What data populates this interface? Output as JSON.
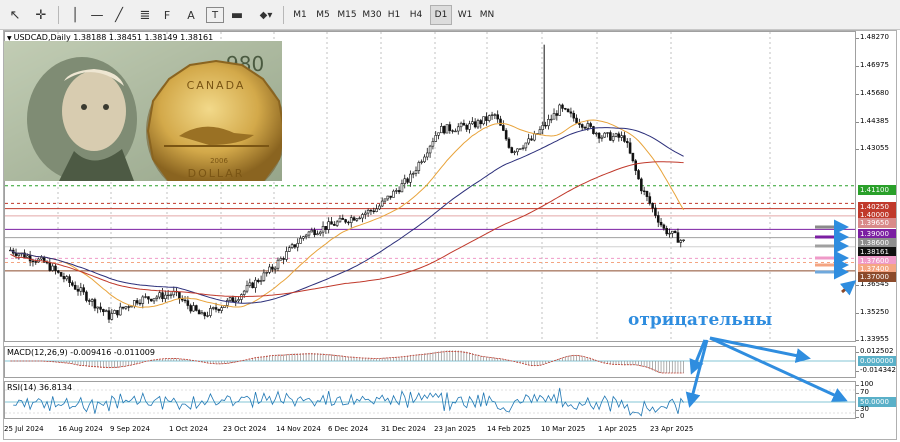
{
  "toolbar": {
    "tools": [
      {
        "name": "cursor-icon",
        "glyph": "↖"
      },
      {
        "name": "crosshair-icon",
        "glyph": "✛"
      },
      {
        "name": "horizontal-line-icon",
        "glyph": "—"
      },
      {
        "name": "trendline-icon",
        "glyph": "╱"
      },
      {
        "name": "channel-icon",
        "glyph": "≣"
      },
      {
        "name": "fibonacci-icon",
        "glyph": "F"
      },
      {
        "name": "text-tool-icon",
        "glyph": "A"
      },
      {
        "name": "text-label-icon",
        "glyph": "T"
      },
      {
        "name": "rectangle-icon",
        "glyph": "▬"
      },
      {
        "name": "shapes-menu-icon",
        "glyph": "◆▾"
      }
    ],
    "timeframes": [
      "M1",
      "M5",
      "M15",
      "M30",
      "H1",
      "H4",
      "D1",
      "W1",
      "MN"
    ],
    "active_timeframe": "D1"
  },
  "chart": {
    "header": "USDCAD,Daily  1.38188 1.38451 1.38149 1.38161",
    "price_ticks": [
      "1.48270",
      "1.46975",
      "1.45680",
      "1.44385",
      "1.43055",
      "1.41100",
      "1.39000",
      "1.38600",
      "1.37000",
      "1.36545",
      "1.35250",
      "1.33955"
    ],
    "level_labels": [
      {
        "text": "1.41100",
        "color": "#2aa02a"
      },
      {
        "text": "1.40250",
        "color": "#c0392b"
      },
      {
        "text": "1.40000",
        "color": "#c0392b"
      },
      {
        "text": "1.39650",
        "color": "#d98a8a"
      },
      {
        "text": "1.39000",
        "color": "#7b1fa2"
      },
      {
        "text": "1.38600",
        "color": "#8e8e8e"
      },
      {
        "text": "1.38161",
        "color": "#101010"
      },
      {
        "text": "1.37600",
        "color": "#ef9ac8"
      },
      {
        "text": "1.37400",
        "color": "#f4a582"
      },
      {
        "text": "1.37000",
        "color": "#8b4a2b"
      }
    ],
    "dates": [
      "25 Jul 2024",
      "16 Aug 2024",
      "9 Sep 2024",
      "1 Oct 2024",
      "23 Oct 2024",
      "14 Nov 2024",
      "6 Dec 2024",
      "31 Dec 2024",
      "23 Jan 2025",
      "14 Feb 2025",
      "10 Mar 2025",
      "1 Apr 2025",
      "23 Apr 2025"
    ],
    "annotation": "отрицательны",
    "coin_texts": {
      "top": "CANADA",
      "bottom": "DOLLAR",
      "year": "2006",
      "bill_serial": "980"
    }
  },
  "macd": {
    "header": "MACD(12,26,9) -0.009416 -0.011009",
    "ticks": [
      "0.012502",
      "0.000000",
      "-0.014342"
    ]
  },
  "rsi": {
    "header": "RSI(14) 36.8134",
    "ticks": [
      "100",
      "70",
      "50.0000",
      "30",
      "0"
    ]
  },
  "colors": {
    "bull": "#1a1a1a",
    "ma_fast": "#e8a33a",
    "ma_mid": "#2c2f7a",
    "ma_slow": "#c0392b",
    "annotation": "#2f8ddf",
    "macd": "#c0392b",
    "rsi": "#1f77b4"
  }
}
